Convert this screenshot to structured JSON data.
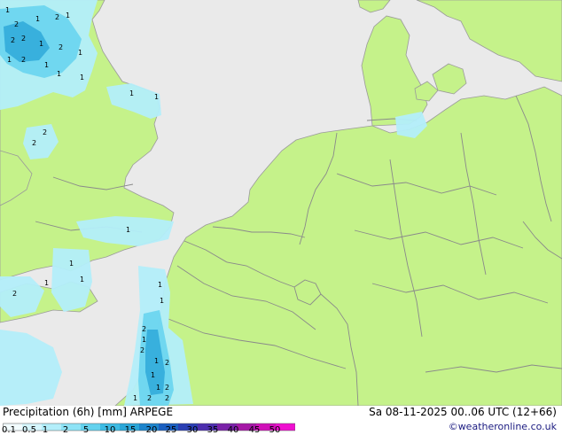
{
  "map": {
    "colors": {
      "sea": "#eaeaea",
      "land": "#c5f28a",
      "border": "#8a8a8a",
      "coast": "#9a9a9a",
      "precip_light": "#b3eefa",
      "precip_mid": "#64d2ee",
      "precip_heavy": "#2aa6d8"
    },
    "precip_labels": [
      "1",
      "2",
      "1",
      "2",
      "1",
      "2",
      "2",
      "1",
      "2",
      "1",
      "1",
      "2",
      "1",
      "1",
      "1",
      "1",
      "2",
      "2",
      "1",
      "1",
      "1",
      "1",
      "1",
      "2",
      "1",
      "1",
      "2",
      "1",
      "2",
      "1",
      "2",
      "1",
      "1",
      "2",
      "2",
      "2",
      "1"
    ]
  },
  "footer": {
    "title": "Precipitation (6h) [mm] ARPEGE",
    "datetime": "Sa 08-11-2025 00..06 UTC (12+66)",
    "copyright": "©weatheronline.co.uk",
    "scale_ticks": [
      "0.1",
      "0.5",
      "1",
      "2",
      "5",
      "10",
      "15",
      "20",
      "25",
      "30",
      "35",
      "40",
      "45",
      "50"
    ],
    "scale_colors": [
      "#f2fcff",
      "#d6f6fe",
      "#b3eefa",
      "#8ee3f6",
      "#64d2ee",
      "#3cbbe4",
      "#2aa6d8",
      "#1c84cc",
      "#1b5fc0",
      "#2a3fb4",
      "#4d2eae",
      "#7a22a8",
      "#a518a6",
      "#d010b8",
      "#ef0fd0"
    ]
  }
}
